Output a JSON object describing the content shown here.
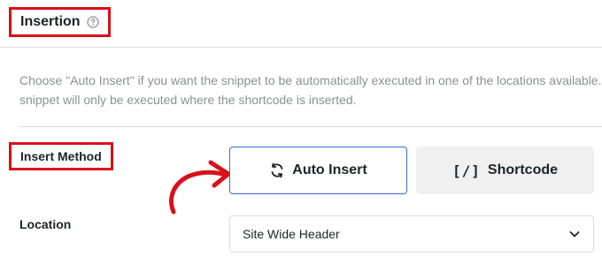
{
  "section": {
    "title": "Insertion",
    "help_icon": "question-circle-icon"
  },
  "description": {
    "line1": "Choose \"Auto Insert\" if you want the snippet to be automatically executed in one of the locations available. In",
    "line2": "snippet will only be executed where the shortcode is inserted."
  },
  "insert_method": {
    "label": "Insert Method",
    "options": [
      {
        "label": "Auto Insert",
        "icon": "refresh-arrows-icon",
        "selected": true
      },
      {
        "label": "Shortcode",
        "icon": "shortcode-brackets-icon",
        "glyph": "[/]",
        "selected": false
      }
    ]
  },
  "location": {
    "label": "Location",
    "selected_value": "Site Wide Header"
  },
  "colors": {
    "highlight_border": "#d9101a",
    "selected_border": "#2f6fd1",
    "annotation_arrow": "#d9101a"
  }
}
